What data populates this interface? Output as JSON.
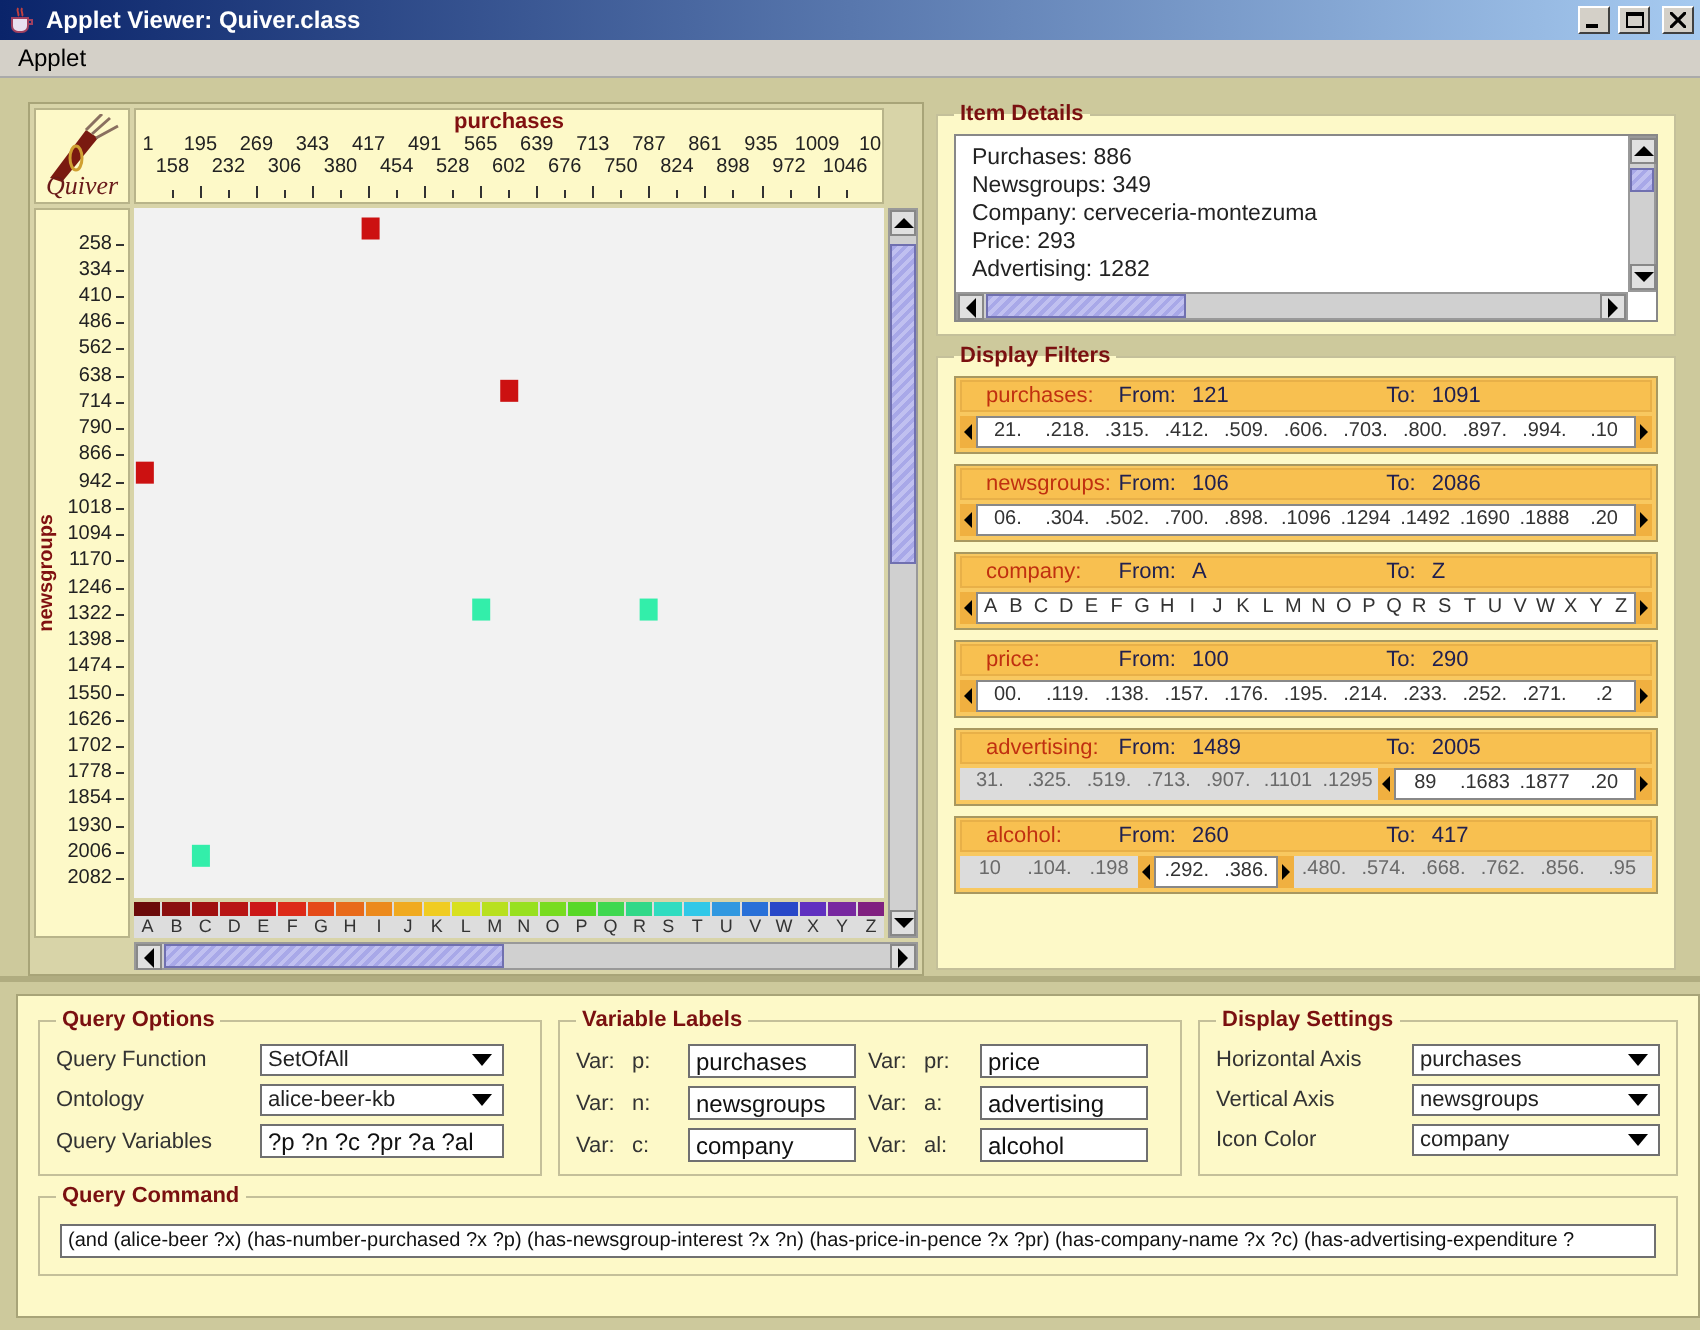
{
  "window": {
    "title": "Applet Viewer: Quiver.class"
  },
  "menu": [
    "Applet"
  ],
  "plot": {
    "logo_text": "Quiver",
    "chart_data": {
      "type": "scatter",
      "xlabel": "purchases",
      "ylabel": "newsgroups",
      "xlim": [
        110,
        1100
      ],
      "ylim": [
        2144,
        163
      ],
      "xticks": [
        {
          "value": 195,
          "label": "195"
        },
        {
          "value": 269,
          "label": "269"
        },
        {
          "value": 343,
          "label": "343"
        },
        {
          "value": 417,
          "label": "417"
        },
        {
          "value": 491,
          "label": "491"
        },
        {
          "value": 565,
          "label": "565"
        },
        {
          "value": 639,
          "label": "639"
        },
        {
          "value": 713,
          "label": "713"
        },
        {
          "value": 787,
          "label": "787"
        },
        {
          "value": 861,
          "label": "861"
        },
        {
          "value": 935,
          "label": "935"
        },
        {
          "value": 1009,
          "label": "1009"
        }
      ],
      "yticks": [
        {
          "value": 258,
          "label": "258"
        },
        {
          "value": 334,
          "label": "334"
        },
        {
          "value": 410,
          "label": "410"
        },
        {
          "value": 486,
          "label": "486"
        },
        {
          "value": 562,
          "label": "562"
        },
        {
          "value": 638,
          "label": "638"
        },
        {
          "value": 714,
          "label": "714"
        },
        {
          "value": 790,
          "label": "790"
        },
        {
          "value": 866,
          "label": "866"
        },
        {
          "value": 942,
          "label": "942"
        },
        {
          "value": 1018,
          "label": "1018"
        },
        {
          "value": 1094,
          "label": "1094"
        },
        {
          "value": 1170,
          "label": "1170"
        },
        {
          "value": 1246,
          "label": "1246"
        },
        {
          "value": 1322,
          "label": "1322"
        },
        {
          "value": 1398,
          "label": "1398"
        },
        {
          "value": 1474,
          "label": "1474"
        },
        {
          "value": 1550,
          "label": "1550"
        },
        {
          "value": 1626,
          "label": "1626"
        },
        {
          "value": 1702,
          "label": "1702"
        },
        {
          "value": 1778,
          "label": "1778"
        },
        {
          "value": 1854,
          "label": "1854"
        },
        {
          "value": 1930,
          "label": "1930"
        },
        {
          "value": 2006,
          "label": "2006"
        },
        {
          "value": 2082,
          "label": "2082"
        }
      ],
      "x": [
        123,
        197,
        421,
        567,
        604,
        788
      ],
      "series": [
        {
          "color": "#cc1111",
          "values": [
            920,
            null,
            219,
            null,
            685,
            null
          ]
        },
        {
          "color": "#33eeaa",
          "values": [
            null,
            2020,
            null,
            1313,
            null,
            1313
          ]
        }
      ]
    },
    "x_axis_cut_labels": [
      "1",
      "10"
    ],
    "x_axis_second_row": [
      "158",
      "232",
      "306",
      "380",
      "454",
      "528",
      "602",
      "676",
      "750",
      "824",
      "898",
      "972",
      "1046"
    ],
    "color_legend": [
      {
        "label": "A",
        "color": "#6b0a0a"
      },
      {
        "label": "B",
        "color": "#8b0f0f"
      },
      {
        "label": "C",
        "color": "#a01010"
      },
      {
        "label": "D",
        "color": "#b81515"
      },
      {
        "label": "E",
        "color": "#cc1818"
      },
      {
        "label": "F",
        "color": "#dd2a18"
      },
      {
        "label": "G",
        "color": "#e54a18"
      },
      {
        "label": "H",
        "color": "#e86a1a"
      },
      {
        "label": "I",
        "color": "#ec8a1c"
      },
      {
        "label": "J",
        "color": "#f0aa20"
      },
      {
        "label": "K",
        "color": "#f0cc22"
      },
      {
        "label": "L",
        "color": "#d8e020"
      },
      {
        "label": "M",
        "color": "#b8e020"
      },
      {
        "label": "N",
        "color": "#98e020"
      },
      {
        "label": "O",
        "color": "#78dc20"
      },
      {
        "label": "P",
        "color": "#58d828"
      },
      {
        "label": "Q",
        "color": "#40d850"
      },
      {
        "label": "R",
        "color": "#30d888"
      },
      {
        "label": "S",
        "color": "#30dcc0"
      },
      {
        "label": "T",
        "color": "#30c8e8"
      },
      {
        "label": "U",
        "color": "#3098e0"
      },
      {
        "label": "V",
        "color": "#2870d8"
      },
      {
        "label": "W",
        "color": "#2848c8"
      },
      {
        "label": "X",
        "color": "#6030c0"
      },
      {
        "label": "Y",
        "color": "#7828a0"
      },
      {
        "label": "Z",
        "color": "#802080"
      }
    ]
  },
  "item_details": {
    "title": "Item Details",
    "lines": [
      "Purchases: 886",
      "Newsgroups: 349",
      "Company: cerveceria-montezuma",
      "Price: 293",
      "Advertising: 1282"
    ]
  },
  "display_filters": {
    "title": "Display Filters",
    "filters": [
      {
        "name": "purchases:",
        "from_label": "From:",
        "from": "121",
        "to_label": "To:",
        "to": "1091",
        "ticks": [
          {
            "label": "21.",
            "selected": true
          },
          {
            "label": ".218.",
            "selected": true
          },
          {
            "label": ".315.",
            "selected": true
          },
          {
            "label": ".412.",
            "selected": true
          },
          {
            "label": ".509.",
            "selected": true
          },
          {
            "label": ".606.",
            "selected": true
          },
          {
            "label": ".703.",
            "selected": true
          },
          {
            "label": ".800.",
            "selected": true
          },
          {
            "label": ".897.",
            "selected": true
          },
          {
            "label": ".994.",
            "selected": true
          },
          {
            "label": ".10",
            "selected": true
          }
        ]
      },
      {
        "name": "newsgroups:",
        "from_label": "From:",
        "from": "106",
        "to_label": "To:",
        "to": "2086",
        "ticks": [
          {
            "label": "06.",
            "selected": true
          },
          {
            "label": ".304.",
            "selected": true
          },
          {
            "label": ".502.",
            "selected": true
          },
          {
            "label": ".700.",
            "selected": true
          },
          {
            "label": ".898.",
            "selected": true
          },
          {
            "label": ".1096",
            "selected": true
          },
          {
            "label": ".1294",
            "selected": true
          },
          {
            "label": ".1492",
            "selected": true
          },
          {
            "label": ".1690",
            "selected": true
          },
          {
            "label": ".1888",
            "selected": true
          },
          {
            "label": ".20",
            "selected": true
          }
        ]
      },
      {
        "name": "company:",
        "from_label": "From:",
        "from": "A",
        "to_label": "To:",
        "to": "Z",
        "ticks": [
          {
            "label": "A",
            "selected": true
          },
          {
            "label": "B",
            "selected": true
          },
          {
            "label": "C",
            "selected": true
          },
          {
            "label": "D",
            "selected": true
          },
          {
            "label": "E",
            "selected": true
          },
          {
            "label": "F",
            "selected": true
          },
          {
            "label": "G",
            "selected": true
          },
          {
            "label": "H",
            "selected": true
          },
          {
            "label": "I",
            "selected": true
          },
          {
            "label": "J",
            "selected": true
          },
          {
            "label": "K",
            "selected": true
          },
          {
            "label": "L",
            "selected": true
          },
          {
            "label": "M",
            "selected": true
          },
          {
            "label": "N",
            "selected": true
          },
          {
            "label": "O",
            "selected": true
          },
          {
            "label": "P",
            "selected": true
          },
          {
            "label": "Q",
            "selected": true
          },
          {
            "label": "R",
            "selected": true
          },
          {
            "label": "S",
            "selected": true
          },
          {
            "label": "T",
            "selected": true
          },
          {
            "label": "U",
            "selected": true
          },
          {
            "label": "V",
            "selected": true
          },
          {
            "label": "W",
            "selected": true
          },
          {
            "label": "X",
            "selected": true
          },
          {
            "label": "Y",
            "selected": true
          },
          {
            "label": "Z",
            "selected": true
          }
        ]
      },
      {
        "name": "price:",
        "from_label": "From:",
        "from": "100",
        "to_label": "To:",
        "to": "290",
        "ticks": [
          {
            "label": "00.",
            "selected": true
          },
          {
            "label": ".119.",
            "selected": true
          },
          {
            "label": ".138.",
            "selected": true
          },
          {
            "label": ".157.",
            "selected": true
          },
          {
            "label": ".176.",
            "selected": true
          },
          {
            "label": ".195.",
            "selected": true
          },
          {
            "label": ".214.",
            "selected": true
          },
          {
            "label": ".233.",
            "selected": true
          },
          {
            "label": ".252.",
            "selected": true
          },
          {
            "label": ".271.",
            "selected": true
          },
          {
            "label": ".2",
            "selected": true
          }
        ]
      },
      {
        "name": "advertising:",
        "from_label": "From:",
        "from": "1489",
        "to_label": "To:",
        "to": "2005",
        "ticks": [
          {
            "label": "31.",
            "selected": false
          },
          {
            "label": ".325.",
            "selected": false
          },
          {
            "label": ".519.",
            "selected": false
          },
          {
            "label": ".713.",
            "selected": false
          },
          {
            "label": ".907.",
            "selected": false
          },
          {
            "label": ".1101",
            "selected": false
          },
          {
            "label": ".1295",
            "selected": false
          },
          {
            "label": "89",
            "selected": true
          },
          {
            "label": ".1683",
            "selected": true
          },
          {
            "label": ".1877",
            "selected": true
          },
          {
            "label": ".20",
            "selected": true
          }
        ]
      },
      {
        "name": "alcohol:",
        "from_label": "From:",
        "from": "260",
        "to_label": "To:",
        "to": "417",
        "ticks": [
          {
            "label": "10",
            "selected": false
          },
          {
            "label": ".104.",
            "selected": false
          },
          {
            "label": ".198",
            "selected": false
          },
          {
            "label": ".292.",
            "selected": true
          },
          {
            "label": ".386.",
            "selected": true
          },
          {
            "label": ".480.",
            "selected": false
          },
          {
            "label": ".574.",
            "selected": false
          },
          {
            "label": ".668.",
            "selected": false
          },
          {
            "label": ".762.",
            "selected": false
          },
          {
            "label": ".856.",
            "selected": false
          },
          {
            "label": ".95",
            "selected": false
          }
        ]
      }
    ]
  },
  "query_options": {
    "title": "Query Options",
    "fields": [
      {
        "kind": "dropdown",
        "label": "Query Function",
        "value": "SetOfAll"
      },
      {
        "kind": "dropdown",
        "label": "Ontology",
        "value": "alice-beer-kb"
      },
      {
        "kind": "text",
        "label": "Query Variables",
        "value": "?p ?n ?c ?pr ?a ?al"
      }
    ]
  },
  "variable_labels": {
    "title": "Variable Labels",
    "vars": [
      {
        "prefix": "Var:",
        "name": "p:",
        "value": "purchases"
      },
      {
        "prefix": "Var:",
        "name": "pr:",
        "value": "price"
      },
      {
        "prefix": "Var:",
        "name": "n:",
        "value": "newsgroups"
      },
      {
        "prefix": "Var:",
        "name": "a:",
        "value": "advertising"
      },
      {
        "prefix": "Var:",
        "name": "c:",
        "value": "company"
      },
      {
        "prefix": "Var:",
        "name": "al:",
        "value": "alcohol"
      }
    ]
  },
  "display_settings": {
    "title": "Display Settings",
    "fields": [
      {
        "kind": "dropdown",
        "label": "Horizontal Axis",
        "value": "purchases"
      },
      {
        "kind": "dropdown",
        "label": "Vertical Axis",
        "value": "newsgroups"
      },
      {
        "kind": "dropdown",
        "label": "Icon Color",
        "value": "company"
      }
    ]
  },
  "query_command": {
    "title": "Query Command",
    "value": "(and (alice-beer ?x) (has-number-purchased ?x ?p) (has-newsgroup-interest ?x ?n) (has-price-in-pence ?x ?pr) (has-company-name ?x ?c) (has-advertising-expenditure ?"
  }
}
